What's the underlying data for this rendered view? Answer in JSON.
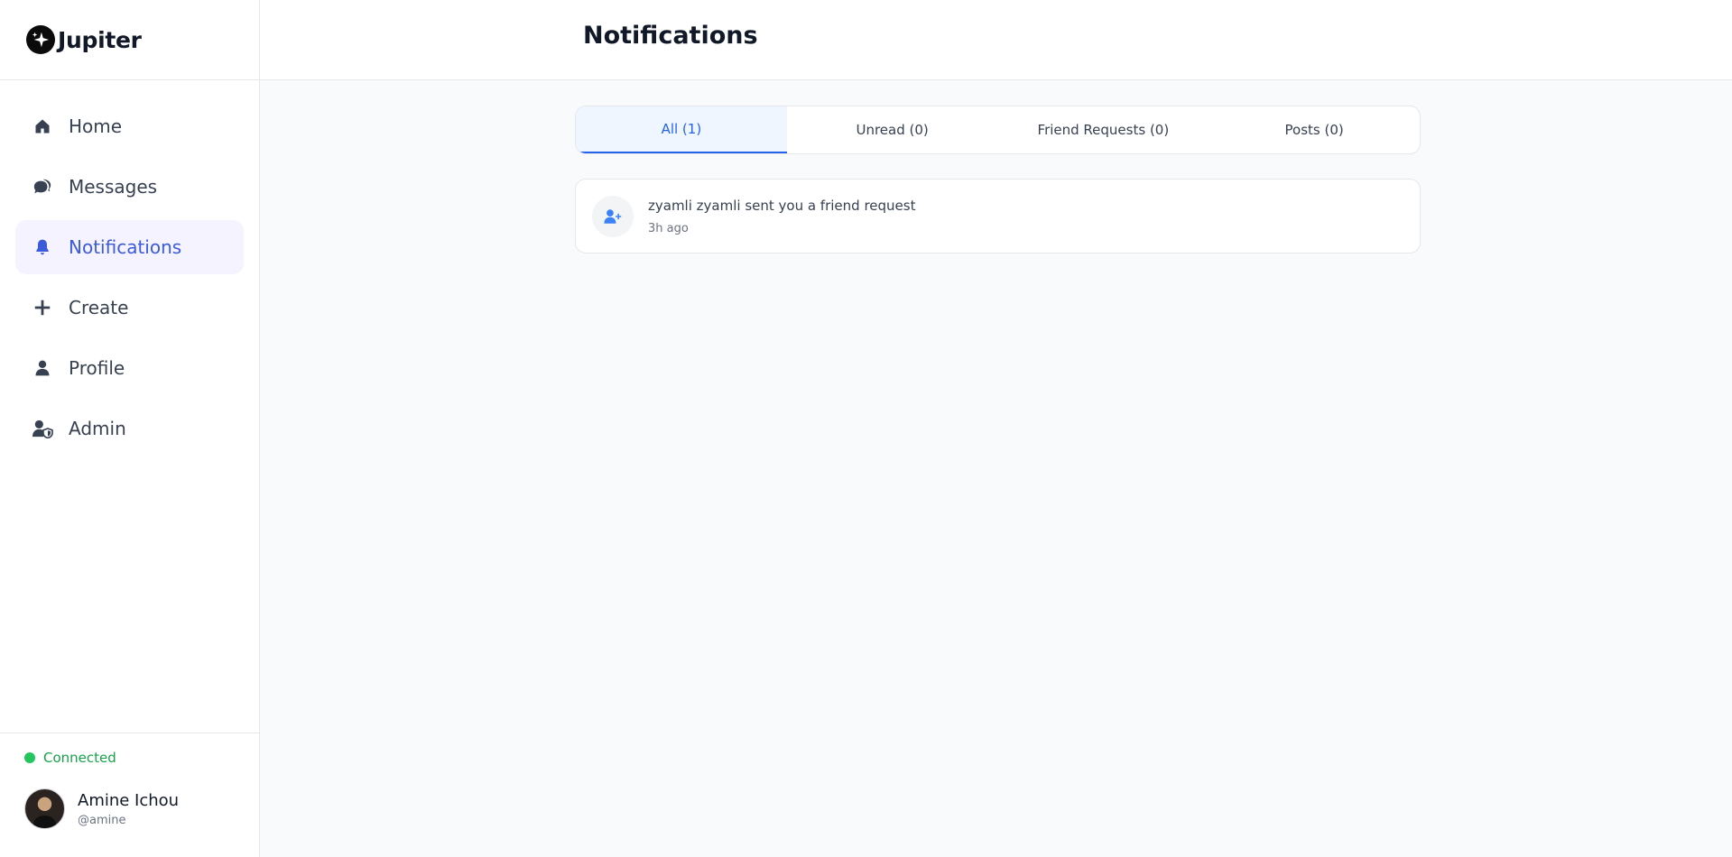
{
  "app": {
    "brand": "Jupiter"
  },
  "sidebar": {
    "items": [
      {
        "label": "Home",
        "icon": "home-icon",
        "active": false
      },
      {
        "label": "Messages",
        "icon": "messages-icon",
        "active": false
      },
      {
        "label": "Notifications",
        "icon": "bell-icon",
        "active": true
      },
      {
        "label": "Create",
        "icon": "plus-icon",
        "active": false
      },
      {
        "label": "Profile",
        "icon": "user-icon",
        "active": false
      },
      {
        "label": "Admin",
        "icon": "user-shield-icon",
        "active": false
      }
    ],
    "status": {
      "label": "Connected",
      "color": "#22c55e"
    },
    "user": {
      "name": "Amine Ichou",
      "handle": "@amine"
    }
  },
  "header": {
    "title": "Notifications"
  },
  "tabs": [
    {
      "label": "All (1)",
      "active": true
    },
    {
      "label": "Unread (0)",
      "active": false
    },
    {
      "label": "Friend Requests (0)",
      "active": false
    },
    {
      "label": "Posts (0)",
      "active": false
    }
  ],
  "notifications": [
    {
      "text": "zyamli zyamli sent you a friend request",
      "time": "3h ago",
      "icon": "user-plus-icon"
    }
  ],
  "colors": {
    "accent": "#2563eb",
    "active_nav_bg": "#f5f3ff",
    "active_nav_text": "#3b5bdb",
    "status_green": "#22c55e"
  }
}
